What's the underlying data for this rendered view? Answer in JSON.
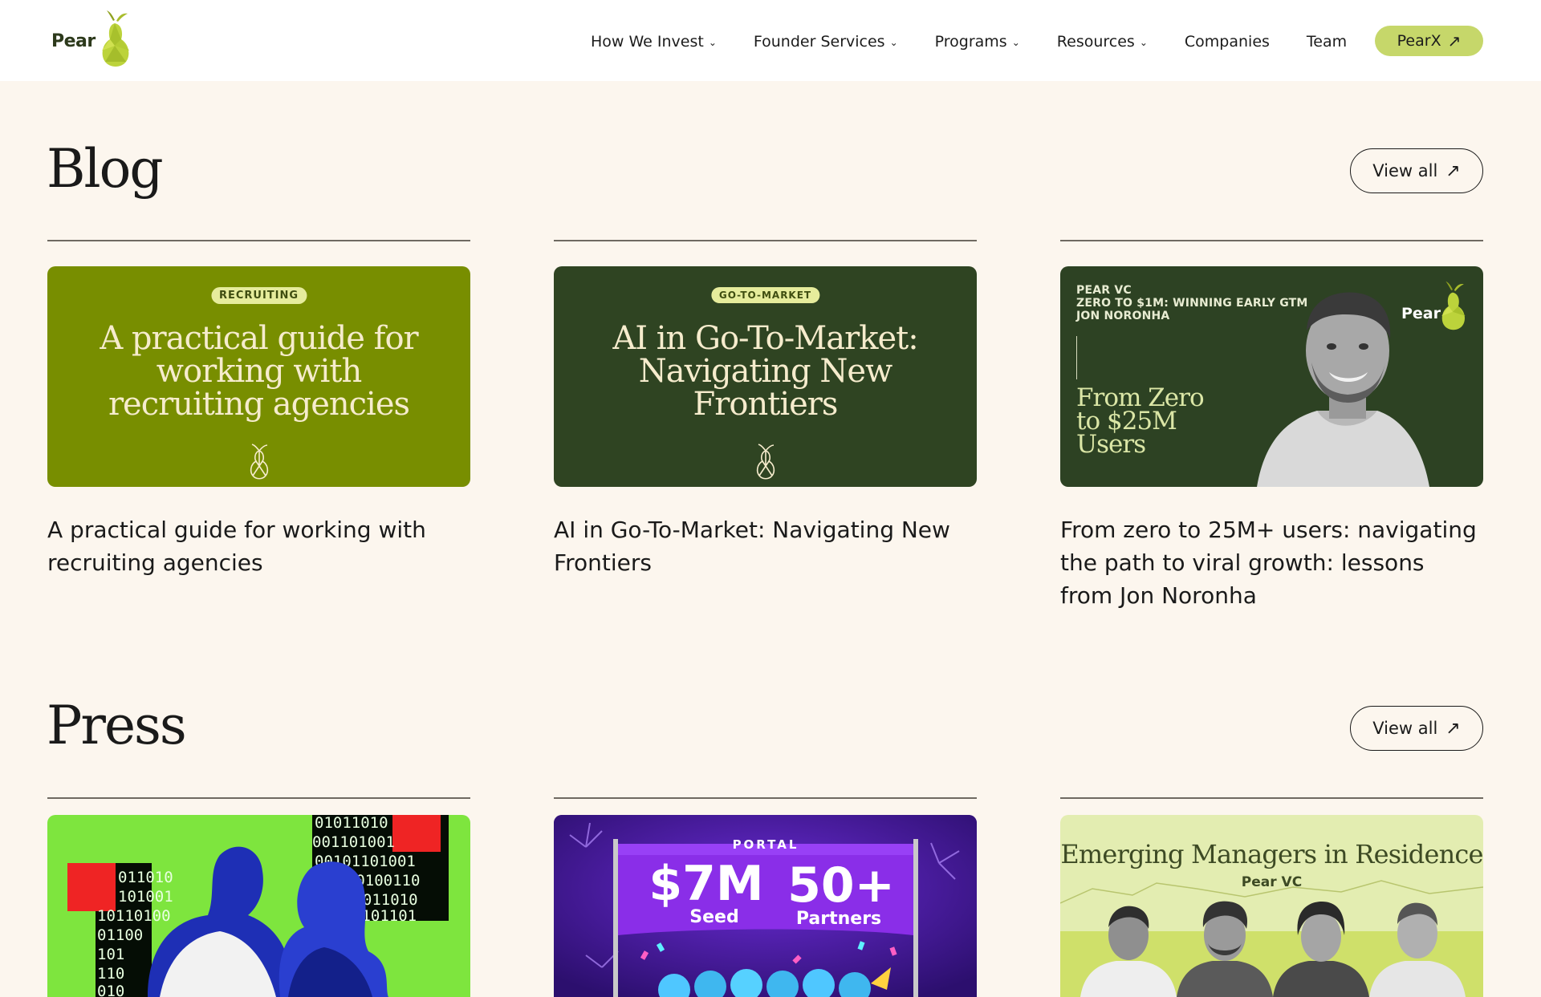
{
  "nav": {
    "logo_text": "Pear",
    "items": [
      {
        "label": "How We Invest",
        "dropdown": true
      },
      {
        "label": "Founder Services",
        "dropdown": true
      },
      {
        "label": "Programs",
        "dropdown": true
      },
      {
        "label": "Resources",
        "dropdown": true
      },
      {
        "label": "Companies",
        "dropdown": false
      },
      {
        "label": "Team",
        "dropdown": false
      }
    ],
    "cta_label": "PearX",
    "chevron_glyph": "⌄",
    "arrow_glyph": "↗"
  },
  "colors": {
    "page_bg": "#fcf6ee",
    "brand_lime": "#c6d76a",
    "card1_bg": "#788e00",
    "card2_bg": "#2f4422",
    "card3_bg": "#2d4223",
    "press1_bg": "#7ee53e",
    "press2_bg": "#4c1e9c",
    "press3_bg": "#e3edb1"
  },
  "blog": {
    "title": "Blog",
    "view_all_label": "View all",
    "cards": [
      {
        "tag": "RECRUITING",
        "headline": "A practical guide for working with recruiting agencies",
        "caption": "A practical guide for working with recruiting agencies"
      },
      {
        "tag": "GO-TO-MARKET",
        "headline": "AI in Go-To-Market: Navigating New Frontiers",
        "caption": "AI in Go-To-Market: Navigating New Frontiers"
      },
      {
        "top_lines": [
          "PEAR VC",
          "ZERO TO $1M: WINNING EARLY GTM",
          "JON NORONHA"
        ],
        "big_text": [
          "From Zero",
          "to $25M",
          "Users"
        ],
        "brand": "Pear",
        "caption": "From zero to 25M+ users: navigating the path to viral growth: lessons from Jon Noronha"
      }
    ]
  },
  "press": {
    "title": "Press",
    "view_all_label": "View all",
    "cards": [
      {
        "binary_lines": [
          "01011010",
          "001101001",
          "00101101001",
          "0010100110",
          "01011010",
          "0101101",
          "011010",
          "101001",
          "10110100",
          "01100",
          "101",
          "110",
          "010"
        ]
      },
      {
        "brand": "PORTAL",
        "left_big": "$7M",
        "left_small": "Seed",
        "right_big": "50+",
        "right_small": "Partners"
      },
      {
        "title": "Emerging Managers in Residence",
        "subtitle": "Pear VC"
      }
    ]
  }
}
